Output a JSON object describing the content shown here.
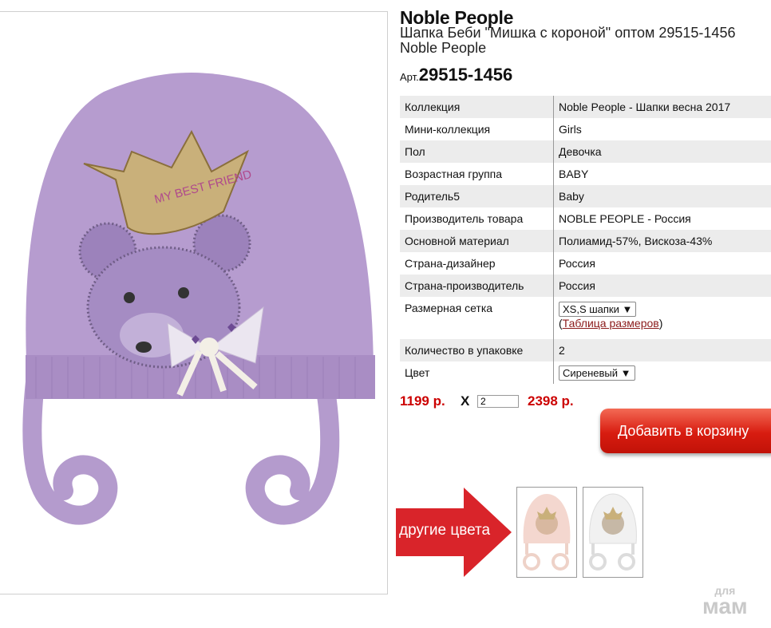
{
  "product": {
    "brand": "Noble People",
    "title": "Шапка Беби \"Мишка с короной\" оптом 29515-1456 Noble People",
    "article_label": "Арт.",
    "article_value": "29515-1456",
    "image_text": "MY BEST FRIEND"
  },
  "specs": [
    {
      "key": "Коллекция",
      "value": "Noble People - Шапки весна 2017"
    },
    {
      "key": "Мини-коллекция",
      "value": "Girls"
    },
    {
      "key": "Пол",
      "value": "Девочка"
    },
    {
      "key": "Возрастная группа",
      "value": "BABY"
    },
    {
      "key": "Родитель5",
      "value": "Baby"
    },
    {
      "key": "Производитель товара",
      "value": "NOBLE PEOPLE - Россия"
    },
    {
      "key": "Основной материал",
      "value": "Полиамид-57%, Вискоза-43%"
    },
    {
      "key": "Страна-дизайнер",
      "value": "Россия"
    },
    {
      "key": "Страна-производитель",
      "value": "Россия"
    },
    {
      "key": "Размерная сетка",
      "select": "XS,S шапки ▼",
      "link_open": "(",
      "link": "Таблица размеров",
      "link_close": ")"
    },
    {
      "key": "Количество в упаковке",
      "value": "2"
    },
    {
      "key": "Цвет",
      "select": "Сиреневый ▼"
    }
  ],
  "order": {
    "price": "1199 р.",
    "multiply": "X",
    "quantity": "2",
    "total": "2398 р.",
    "add_to_cart": "Добавить в корзину"
  },
  "other_colors": {
    "label": "другие цвета",
    "thumbs": [
      {
        "color": "pink",
        "hat_hex": "#f4d7cf"
      },
      {
        "color": "white",
        "hat_hex": "#f1f1f1"
      }
    ]
  },
  "watermark": {
    "line1": "для",
    "line2": "мам"
  },
  "colors": {
    "accent": "#cc0000",
    "hat": "#b69ccf",
    "table_stripe": "#ececec"
  }
}
